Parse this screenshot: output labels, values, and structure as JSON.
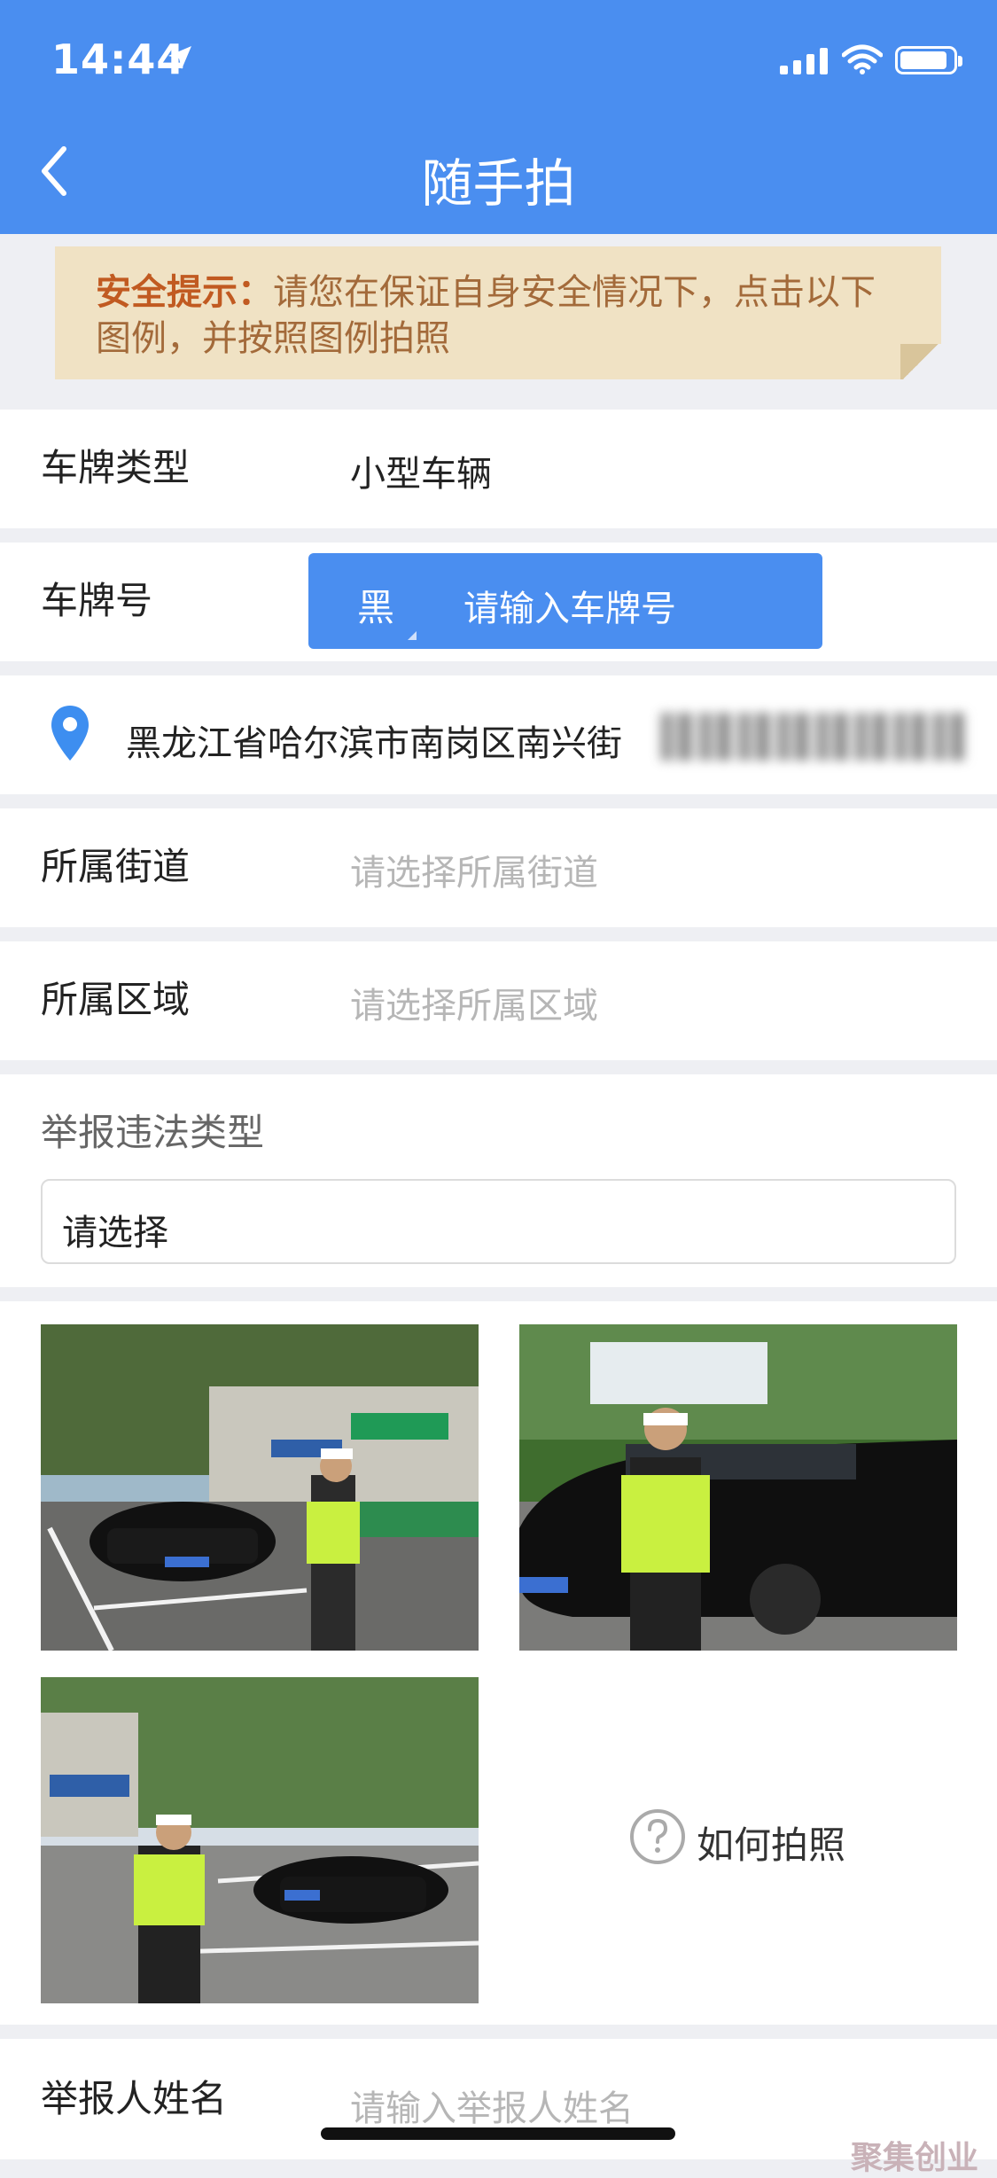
{
  "status_bar": {
    "time": "14:44"
  },
  "nav": {
    "title": "随手拍"
  },
  "notice": {
    "lead": "安全提示：",
    "text": "请您在保证自身安全情况下，点击以下图例，并按照图例拍照"
  },
  "plate_type": {
    "label": "车牌类型",
    "value": "小型车辆"
  },
  "plate_number": {
    "label": "车牌号",
    "province": "黑",
    "placeholder": "请输入车牌号"
  },
  "location": {
    "address": "黑龙江省哈尔滨市南岗区南兴街"
  },
  "street": {
    "label": "所属街道",
    "placeholder": "请选择所属街道"
  },
  "area": {
    "label": "所属区域",
    "placeholder": "请选择所属区域"
  },
  "violation": {
    "label": "举报违法类型",
    "select_value": "请选择"
  },
  "photos": {
    "howto_label": "如何拍照"
  },
  "reporter": {
    "label": "举报人姓名",
    "placeholder": "请输入举报人姓名"
  },
  "watermark": "聚集创业",
  "colors": {
    "brand_blue": "#4a8ef0",
    "notice_bg": "#f0e2c4",
    "notice_lead": "#c15a21"
  }
}
